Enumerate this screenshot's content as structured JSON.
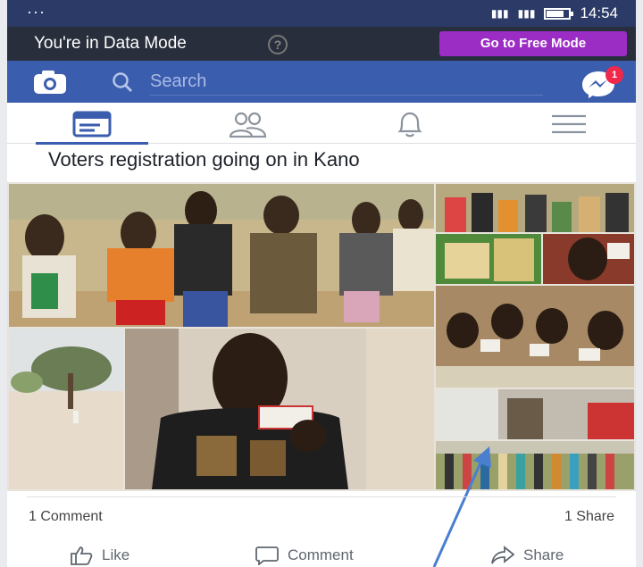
{
  "status_bar": {
    "dots": "···",
    "signal_1": "all",
    "signal_2": "all",
    "time": "14:54",
    "battery_level": 0.7
  },
  "data_banner": {
    "text": "You're in Data Mode",
    "help_icon": "?",
    "button_label": "Go to Free Mode"
  },
  "header": {
    "search_placeholder": "Search",
    "messenger_badge": "1"
  },
  "nav": {
    "tabs": [
      "news-feed",
      "friends",
      "notifications",
      "menu"
    ],
    "active_tab": "news-feed"
  },
  "post": {
    "text": "Voters registration going on in Kano",
    "comments": "1 Comment",
    "shares": "1 Share"
  },
  "actions": {
    "like": "Like",
    "comment": "Comment",
    "share": "Share"
  },
  "colors": {
    "status_bar": "#2b3a67",
    "banner": "#282e3b",
    "free_mode_button": "#9b2cc4",
    "header": "#3b5dad",
    "arrow": "#4a7fd0"
  }
}
